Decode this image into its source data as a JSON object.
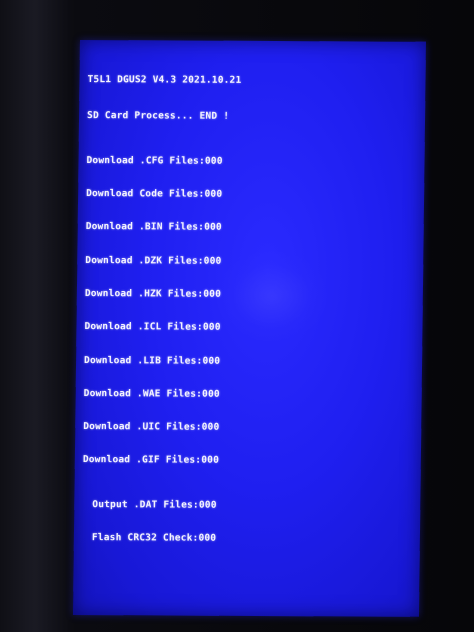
{
  "screen": {
    "header": "T5L1 DGUS2 V4.3 2021.10.21",
    "status": "SD Card Process... END !",
    "downloads": [
      {
        "label": "Download .CFG Files:",
        "value": "000"
      },
      {
        "label": "Download Code Files:",
        "value": "000"
      },
      {
        "label": "Download .BIN Files:",
        "value": "000"
      },
      {
        "label": "Download .DZK Files:",
        "value": "000"
      },
      {
        "label": "Download .HZK Files:",
        "value": "000"
      },
      {
        "label": "Download .ICL Files:",
        "value": "000"
      },
      {
        "label": "Download .LIB Files:",
        "value": "000"
      },
      {
        "label": "Download .WAE Files:",
        "value": "000"
      },
      {
        "label": "Download .UIC Files:",
        "value": "000"
      },
      {
        "label": "Download .GIF Files:",
        "value": "000"
      }
    ],
    "output": {
      "label": "Output .DAT Files:",
      "value": "000"
    },
    "flash": {
      "label": "Flash CRC32 Check:",
      "value": "000"
    }
  },
  "colors": {
    "screen_bg": "#1f1ff0",
    "text": "#f4f4ff",
    "bezel": "#0b0b10"
  }
}
